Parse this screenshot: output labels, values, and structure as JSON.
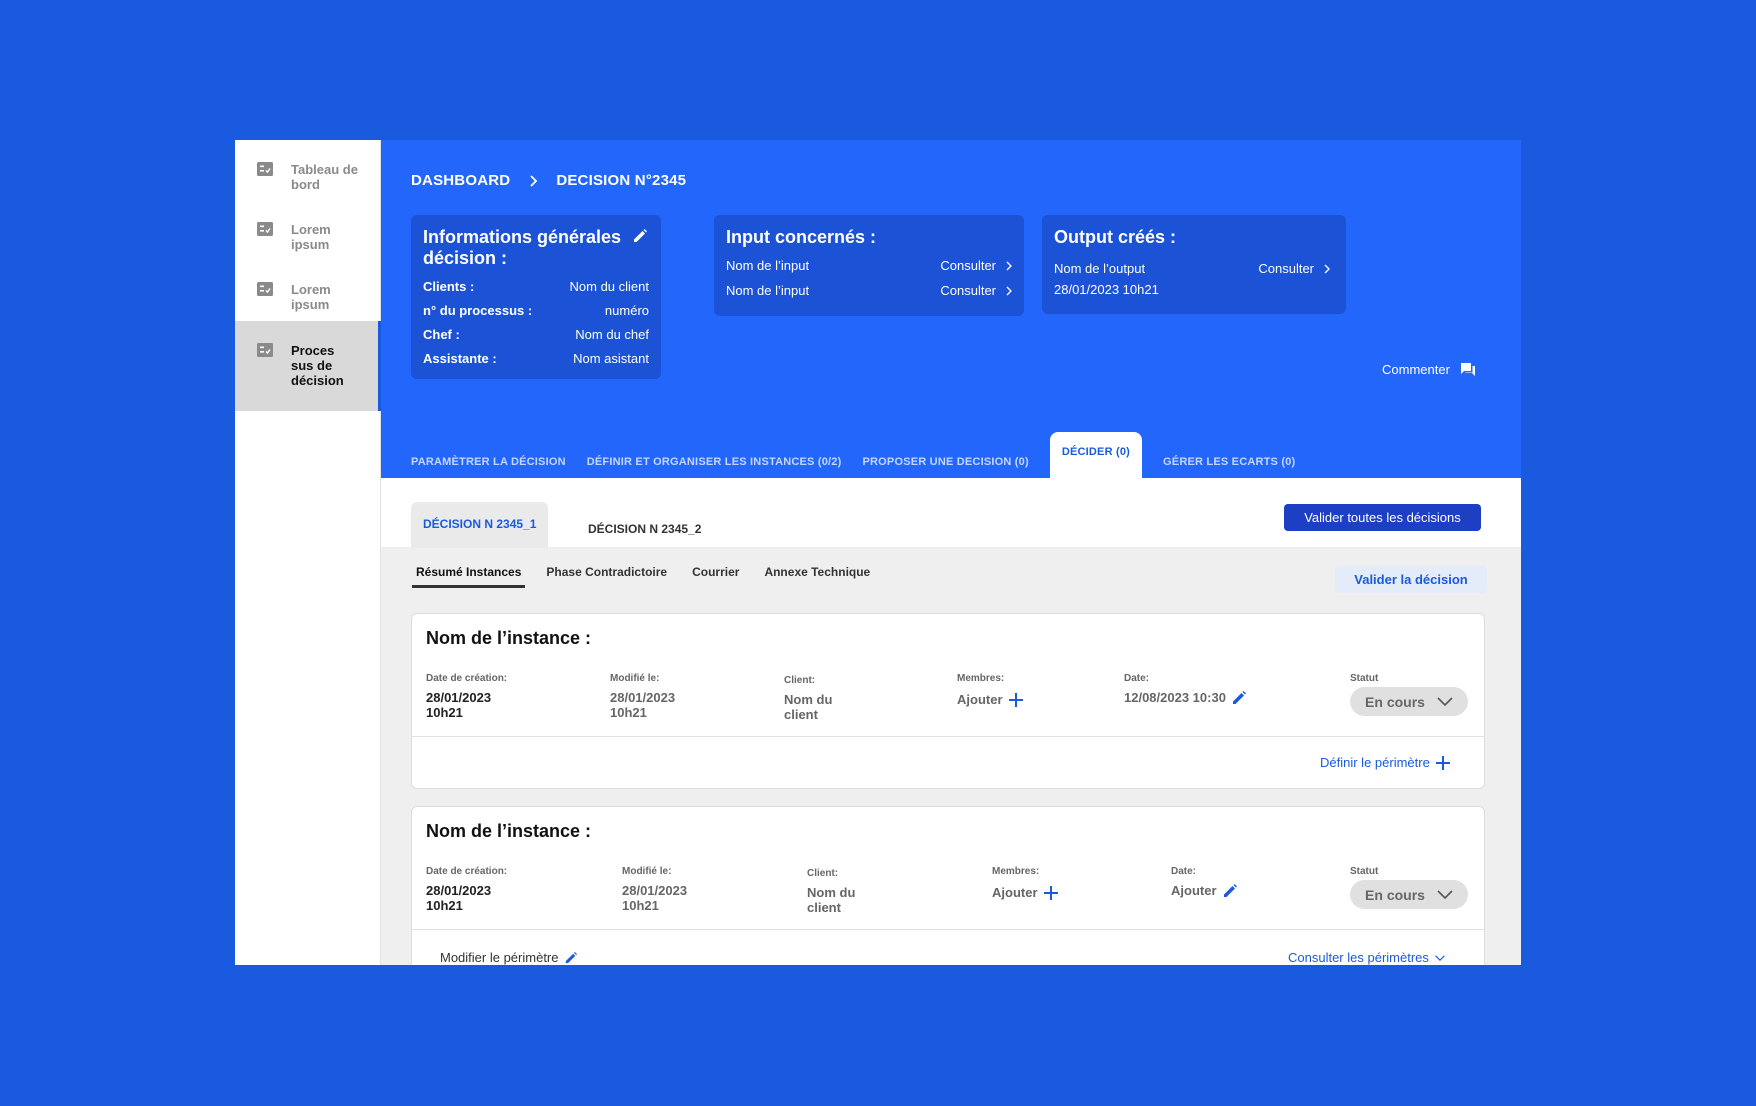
{
  "sidebar": {
    "items": [
      {
        "label": "Tableau de bord",
        "icon": "checklist-icon"
      },
      {
        "label": "Lorem ipsum",
        "icon": "checklist-icon"
      },
      {
        "label": "Lorem ipsum",
        "icon": "checklist-icon"
      },
      {
        "label": "Proces sus de décision",
        "icon": "checklist-icon",
        "active": true
      }
    ]
  },
  "breadcrumb": {
    "root": "DASHBOARD",
    "current": "DECISION N°2345"
  },
  "info_card": {
    "title": "Informations générales décision :",
    "rows": [
      {
        "key": "Clients :",
        "value": "Nom du client"
      },
      {
        "key": "n° du processus :",
        "value": "numéro"
      },
      {
        "key": "Chef :",
        "value": "Nom du chef"
      },
      {
        "key": "Assistante :",
        "value": "Nom asistant"
      }
    ]
  },
  "input_card": {
    "title": "Input concernés :",
    "rows": [
      {
        "name": "Nom de l’input",
        "action": "Consulter"
      },
      {
        "name": "Nom de l’input",
        "action": "Consulter"
      }
    ]
  },
  "output_card": {
    "title": "Output créés :",
    "name": "Nom de l’output",
    "action": "Consulter",
    "date": "28/01/2023 10h21"
  },
  "comment_label": "Commenter",
  "tabs": [
    {
      "label": "PARAMÈTRER LA DÉCISION"
    },
    {
      "label": "DÉFINIR ET ORGANISER LES INSTANCES (0/2)"
    },
    {
      "label": "PROPOSER UNE DECISION (0)"
    },
    {
      "label": "DÉCIDER (0)",
      "active": true
    },
    {
      "label": "GÉRER LES ECARTS (0)"
    }
  ],
  "decision_tabs": [
    {
      "label": "DÉCISION N 2345_1",
      "active": true
    },
    {
      "label": "DÉCISION N 2345_2"
    }
  ],
  "validate_all_label": "Valider toutes les décisions",
  "subtabs": [
    {
      "label": "Résumé Instances",
      "active": true
    },
    {
      "label": "Phase Contradictoire"
    },
    {
      "label": "Courrier"
    },
    {
      "label": "Annexe Technique"
    }
  ],
  "validate_label": "Valider la décision",
  "instances": [
    {
      "title": "Nom de l’instance :",
      "creation_label": "Date de création:",
      "creation_value": "28/01/2023 10h21",
      "modified_label": "Modifié le:",
      "modified_value": "28/01/2023 10h21",
      "client_label": "Client:",
      "client_value": "Nom du client",
      "members_label": "Membres:",
      "members_value": "Ajouter",
      "date_label": "Date:",
      "date_value": "12/08/2023 10:30",
      "status_label": "Statut",
      "status_value": "En cours",
      "footer_link": "Définir le périmètre"
    },
    {
      "title": "Nom de l’instance :",
      "creation_label": "Date de création:",
      "creation_value": "28/01/2023 10h21",
      "modified_label": "Modifié le:",
      "modified_value": "28/01/2023 10h21",
      "client_label": "Client:",
      "client_value": "Nom du client",
      "members_label": "Membres:",
      "members_value": "Ajouter",
      "date_label": "Date:",
      "date_value": "Ajouter",
      "status_label": "Statut",
      "status_value": "En cours",
      "footer_left_link": "Modifier le périmètre",
      "footer_right_link": "Consulter les périmètres"
    }
  ],
  "colors": {
    "background": "#1a5ade",
    "header": "#2266fb",
    "card": "#1c52d6",
    "accent": "#1a5ade"
  }
}
